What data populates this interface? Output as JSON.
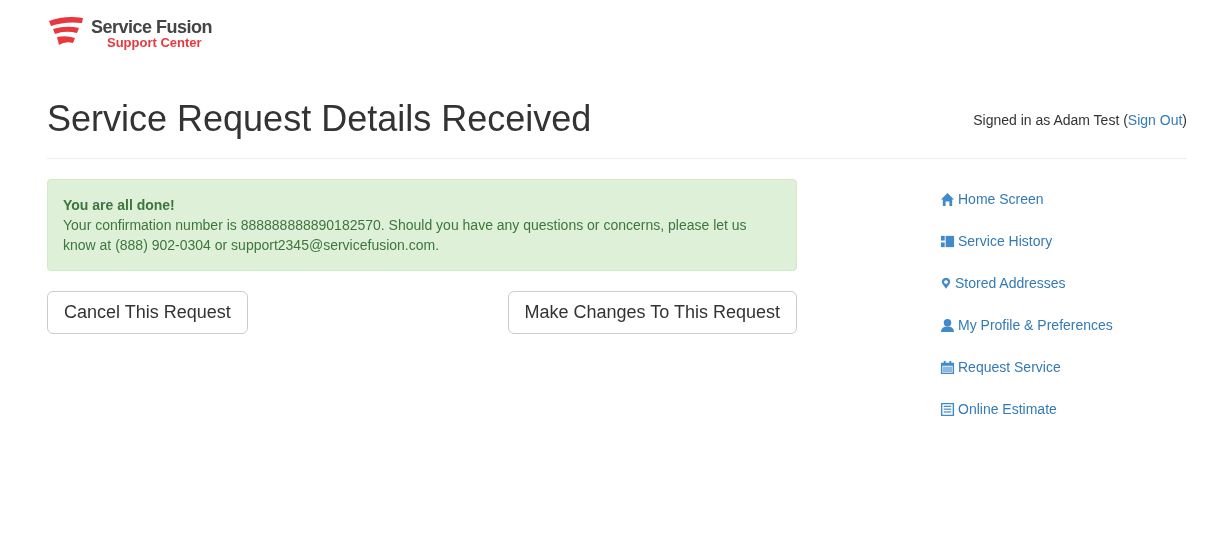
{
  "logo": {
    "name": "Service Fusion",
    "subtitle": "Support Center"
  },
  "page_title": "Service Request Details Received",
  "signed_in": {
    "prefix": "Signed in as Adam Test (",
    "link": "Sign Out",
    "suffix": ")"
  },
  "alert": {
    "heading": "You are all done!",
    "message": "Your confirmation number is 888888888890182570. Should you have any questions or concerns, please let us know at (888) 902-0304 or support2345@servicefusion.com."
  },
  "buttons": [
    {
      "label": "Cancel This Request"
    },
    {
      "label": "Make Changes To This Request"
    }
  ],
  "sidebar": {
    "items": [
      {
        "kind": "home",
        "label": "Home Screen"
      },
      {
        "kind": "history",
        "label": "Service History"
      },
      {
        "kind": "pin",
        "label": "Stored Addresses"
      },
      {
        "kind": "user",
        "label": "My Profile & Preferences"
      },
      {
        "kind": "calendar",
        "label": "Request Service"
      },
      {
        "kind": "list",
        "label": "Online Estimate"
      }
    ]
  }
}
